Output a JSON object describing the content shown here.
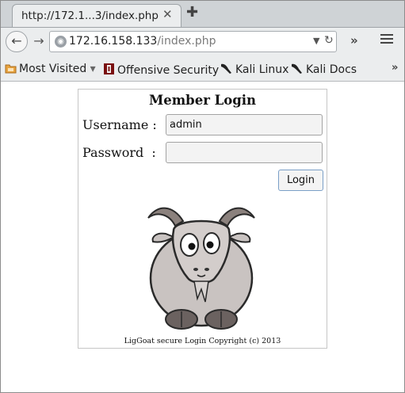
{
  "browser": {
    "tab": {
      "title": "http://172.1...3/index.php",
      "close_glyph": "✕"
    },
    "new_tab_glyph": "✚",
    "nav": {
      "back_glyph": "←",
      "forward_glyph": "→",
      "overflow_glyph": "»"
    },
    "url": {
      "host": "172.16.158.133",
      "path": "/index.php",
      "dropdown_glyph": "▼",
      "reload_glyph": "↻",
      "site_icon": "globe-icon"
    },
    "bookmarks": {
      "items": [
        {
          "label": "Most Visited",
          "icon": "folder-icon",
          "suffix": "▾"
        },
        {
          "label": "Offensive Security",
          "icon": "offsec-icon"
        },
        {
          "label": "Kali Linux",
          "icon": "kali-dragon-icon"
        },
        {
          "label": "Kali Docs",
          "icon": "kali-dragon-icon"
        }
      ],
      "more_glyph": "»"
    }
  },
  "page": {
    "title": "Member Login",
    "username_label": "Username :",
    "password_label": "Password  :",
    "username_value": "admin",
    "password_value": "",
    "login_button": "Login",
    "image": "goat-cartoon",
    "copyright": "LigGoat secure Login Copyright (c) 2013"
  },
  "colors": {
    "chrome_bg": "#ebedee",
    "tabstrip_bg": "#cfd3d6",
    "button_border_focus": "#7a9fc7",
    "goat_body": "#c9c3c1"
  }
}
